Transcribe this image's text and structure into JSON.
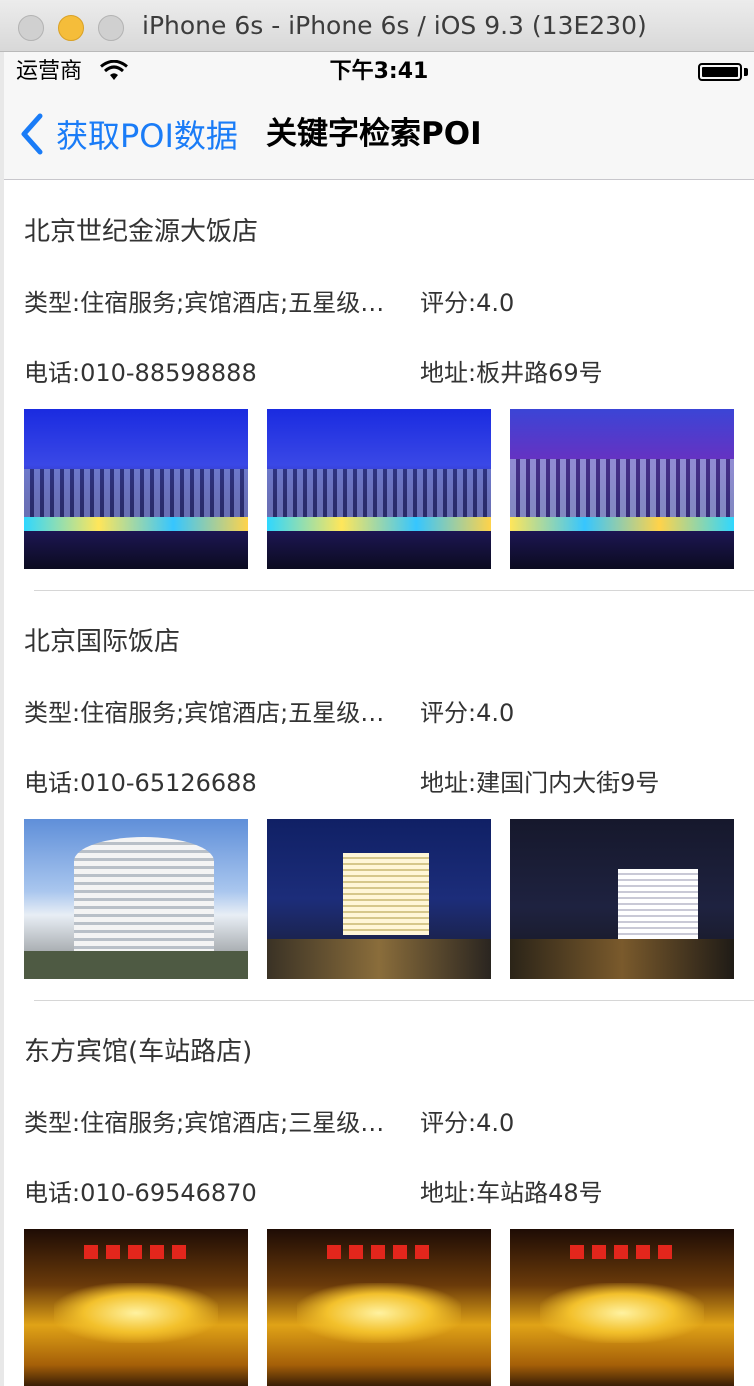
{
  "window": {
    "title": "iPhone 6s - iPhone 6s / iOS 9.3 (13E230)"
  },
  "status_bar": {
    "carrier": "运营商",
    "time": "下午3:41",
    "wifi_icon": "wifi-icon",
    "battery_icon": "battery-icon"
  },
  "nav": {
    "back_label": "获取POI数据",
    "title": "关键字检索POI",
    "accent_color": "#1a7cf7"
  },
  "pois": [
    {
      "name": "北京世纪金源大饭店",
      "type": "类型:住宿服务;宾馆酒店;五星级宾馆",
      "rating": "评分:4.0",
      "phone": "电话:010-88598888",
      "address": "地址:板井路69号"
    },
    {
      "name": "北京国际饭店",
      "type": "类型:住宿服务;宾馆酒店;五星级宾馆",
      "rating": "评分:4.0",
      "phone": "电话:010-65126688",
      "address": "地址:建国门内大街9号"
    },
    {
      "name": "东方宾馆(车站路店)",
      "type": "类型:住宿服务;宾馆酒店;三星级宾馆",
      "rating": "评分:4.0",
      "phone": "电话:010-69546870",
      "address": "地址:车站路48号"
    }
  ]
}
